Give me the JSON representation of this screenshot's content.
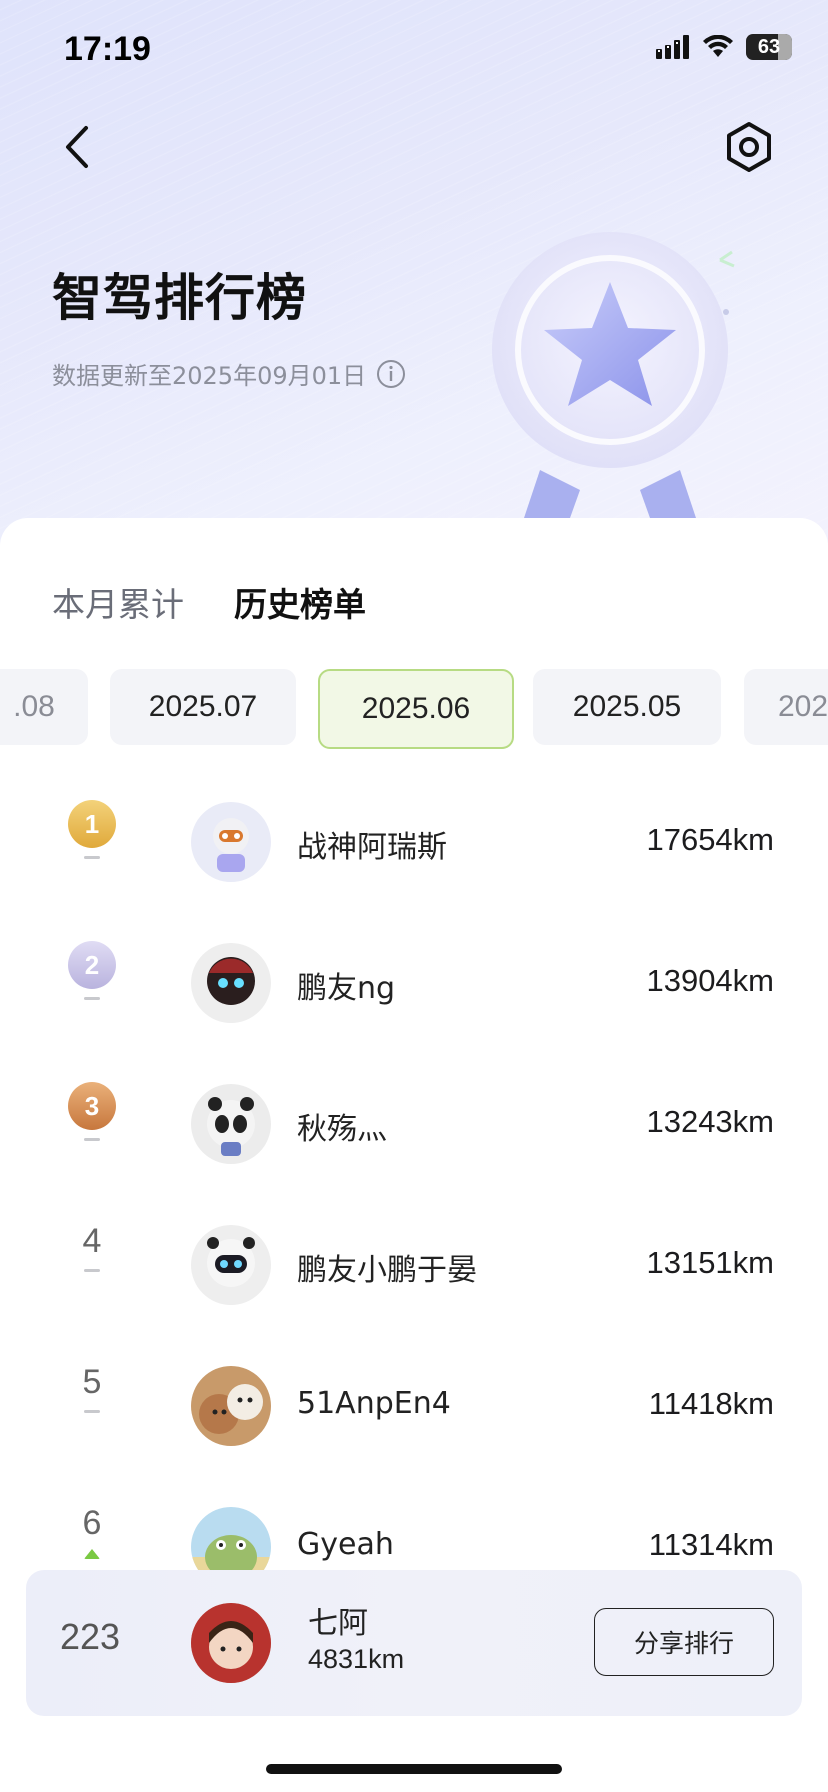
{
  "status_bar": {
    "time": "17:19",
    "battery": "63"
  },
  "header": {
    "title": "智驾排行榜",
    "subtitle": "数据更新至2025年09月01日"
  },
  "tabs": [
    {
      "label": "本月累计",
      "active": false
    },
    {
      "label": "历史榜单",
      "active": true
    }
  ],
  "months": [
    {
      "label": ".08",
      "selected": false
    },
    {
      "label": "2025.07",
      "selected": false
    },
    {
      "label": "2025.06",
      "selected": true
    },
    {
      "label": "2025.05",
      "selected": false
    },
    {
      "label": "202",
      "selected": false
    }
  ],
  "leaderboard": [
    {
      "rank": "1",
      "name": "战神阿瑞斯",
      "distance": "17654km",
      "trend": "flat",
      "badge_color": "#e8b94a"
    },
    {
      "rank": "2",
      "name": "鹏友ng",
      "distance": "13904km",
      "trend": "flat",
      "badge_color": "#c7c3e6"
    },
    {
      "rank": "3",
      "name": "秋殇灬",
      "distance": "13243km",
      "trend": "flat",
      "badge_color": "#d99a5e"
    },
    {
      "rank": "4",
      "name": "鹏友小鹏于晏",
      "distance": "13151km",
      "trend": "flat"
    },
    {
      "rank": "5",
      "name": "51AnpEn4",
      "distance": "11418km",
      "trend": "flat"
    },
    {
      "rank": "6",
      "name": "Gyeah",
      "distance": "11314km",
      "trend": "up"
    }
  ],
  "me": {
    "rank": "223",
    "name": "七阿",
    "distance": "4831km",
    "share_label": "分享排行"
  },
  "colors": {
    "accent_green": "#b7db83",
    "hero_bg": "#dfe3fb"
  }
}
